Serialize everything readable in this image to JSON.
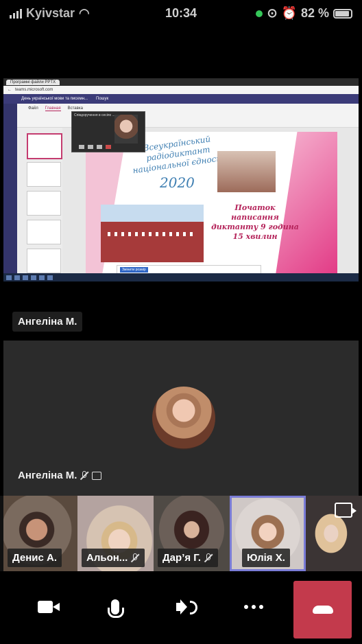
{
  "status_bar": {
    "carrier": "Kyivstar",
    "time": "10:34",
    "battery": "82 %"
  },
  "shared_screen": {
    "browser_tab": "Програмні файли PPTX",
    "url": "teams.microsoft.com",
    "teams_title": "День української мови та писемн...",
    "search": "Пошук",
    "ribbon_tabs": [
      "Файл",
      "Главная",
      "Вставка"
    ],
    "mini_window_title": "Співдоручення в сесіях ...",
    "slide": {
      "title": "Всеукраїнський радіодиктант національної єдності",
      "year": "2020",
      "start_text": "Початок написання диктанту 9 година 15 хвилин"
    },
    "notice_button": "Змінити розмір"
  },
  "presenter_name": "Ангеліна М.",
  "speaker": {
    "name": "Ангеліна М."
  },
  "participants": [
    {
      "name": "Денис А."
    },
    {
      "name": "Альон..."
    },
    {
      "name": "Дар’я Г."
    },
    {
      "name": "Юлія Х."
    }
  ],
  "controls": {
    "camera": "camera-icon",
    "mic": "microphone-icon",
    "speaker": "speaker-icon",
    "more": "more-icon",
    "hangup": "hangup-icon"
  },
  "colors": {
    "hangup": "#c33a4c",
    "active_tile": "#7a7cd6",
    "teams_bar": "#3b3b78"
  }
}
